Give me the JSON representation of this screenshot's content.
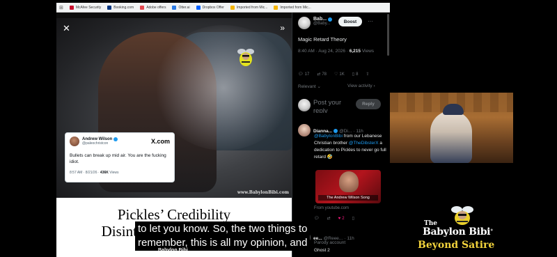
{
  "bookmarks": [
    {
      "label": "McAfee Security",
      "color": "#c8102e"
    },
    {
      "label": "Booking.com",
      "color": "#003580"
    },
    {
      "label": "Adobe offers",
      "color": "#e34850"
    },
    {
      "label": "Otter.ai",
      "color": "#2c7be5"
    },
    {
      "label": "Dropbox Offer",
      "color": "#0061fe"
    },
    {
      "label": "Imported from Mic...",
      "color": "#f4b400"
    },
    {
      "label": "Imported from Mic...",
      "color": "#f4b400"
    }
  ],
  "video": {
    "watermark": "www.BabylonBibi.com",
    "embedded_tweet": {
      "name": "Andrew Wilson",
      "handle": "@paleochristcon",
      "text": "Bullets can break up mid air. You are the fucking idiot.",
      "meta_time": "8:57 AM · 8/21/26 · ",
      "views_count": "436K",
      "views_label": " Views",
      "brand": "X.com"
    }
  },
  "article": {
    "headline_line1": "Pickles’ Credibility",
    "headline_line2": "Disintegrates In Mid-Air"
  },
  "x_panel": {
    "post": {
      "name": "Bab...",
      "handle": "@Baby...",
      "boost_label": "Boost",
      "text": "Magic Retard Theory",
      "time": "8:40 AM · Aug 24, 2026 · ",
      "views_count": "6,215",
      "views_label": "Views",
      "replies": "17",
      "reposts": "78",
      "likes": "1K",
      "bookmarks": "8",
      "relevant_label": "Relevant",
      "view_activity_label": "View activity"
    },
    "reply_box": {
      "placeholder": "Post your reply",
      "button": "Reply"
    },
    "reply1": {
      "name": "Dianna...",
      "handle": "@Di...",
      "time": "11h",
      "mention1": "@BabylonBibi",
      "text1": " from our Lebanese Christian brother ",
      "mention2": "@TheDibsterX",
      "text2": " a dedication to Pickles to never go full retard 🤣",
      "card_title": "The Andrew Wilson Song",
      "card_source": "From youtube.com",
      "reply_count": "2"
    },
    "reply2": {
      "name": "ee...",
      "handle": "@Reee...",
      "time": "11h",
      "text1": "Parody account",
      "text2": "Ghost 2"
    }
  },
  "logo": {
    "line1": "The",
    "line2": "Babylon Bibi",
    "tm": "®",
    "tagline": "Beyond Satire"
  },
  "caption": {
    "line1": "to let you know. So, the two things to",
    "line2": "remember, this is all my opinion, and",
    "tag": "Babylon Bibi"
  },
  "colors": {
    "x_blue": "#1d9bf0",
    "tagline_yellow": "#f2d33c",
    "like_pink": "#f91880"
  }
}
